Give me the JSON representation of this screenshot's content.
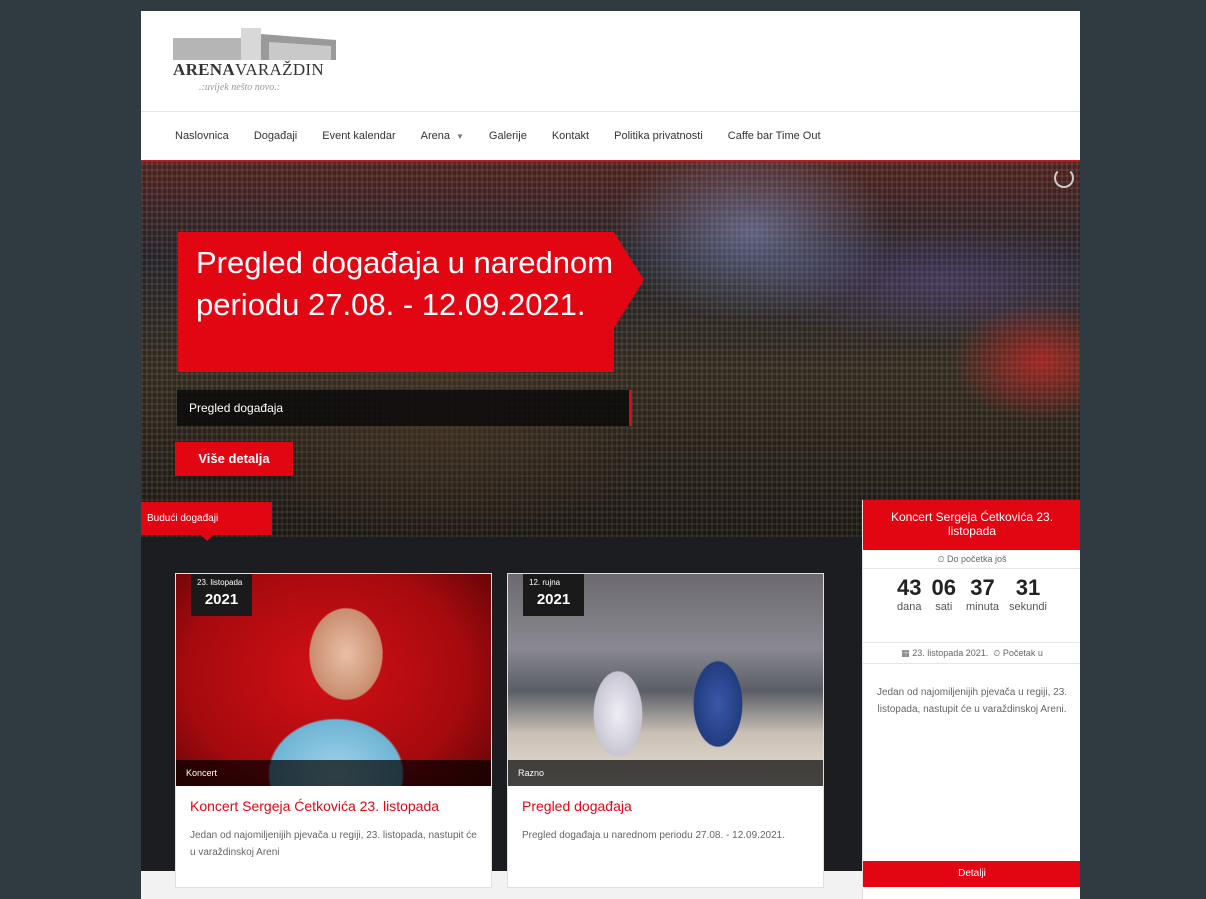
{
  "logo": {
    "brand_bold": "ARENA",
    "brand_regular": "VARAŽDIN",
    "tagline": ".:uvijek nešto novo.:"
  },
  "nav": {
    "items": [
      "Naslovnica",
      "Događaji",
      "Event kalendar",
      "Arena",
      "Galerije",
      "Kontakt",
      "Politika privatnosti",
      "Caffe bar Time Out"
    ]
  },
  "hero": {
    "title": "Pregled događaja u narednom periodu 27.08. - 12.09.2021.",
    "subtitle": "Pregled događaja",
    "button": "Više detalja"
  },
  "upcoming": {
    "tab_label": "Budući događaji"
  },
  "cards": [
    {
      "date_day": "23. listopada",
      "year": "2021",
      "category": "Koncert",
      "title": "Koncert Sergeja Ćetkovića 23. listopada",
      "text": "Jedan od najomiljenijih pjevača u regiji, 23. listopada, nastupit će u varaždinskoj Areni"
    },
    {
      "date_day": "12. rujna",
      "year": "2021",
      "category": "Razno",
      "title": "Pregled događaja",
      "text": "Pregled događaja u narednom periodu 27.08. - 12.09.2021."
    }
  ],
  "countdown": {
    "title": "Koncert Sergeja Ćetkovića 23. listopada",
    "until_label": "Do početka još",
    "units": [
      {
        "value": "43",
        "label": "dana"
      },
      {
        "value": "06",
        "label": "sati"
      },
      {
        "value": "37",
        "label": "minuta"
      },
      {
        "value": "31",
        "label": "sekundi"
      }
    ],
    "date": "23. listopada 2021.",
    "start_label": "Početak u",
    "description": "Jedan od najomiljenijih pjevača u regiji, 23. listopada, nastupit će u varaždinskoj Areni.",
    "button": "Detalji"
  }
}
